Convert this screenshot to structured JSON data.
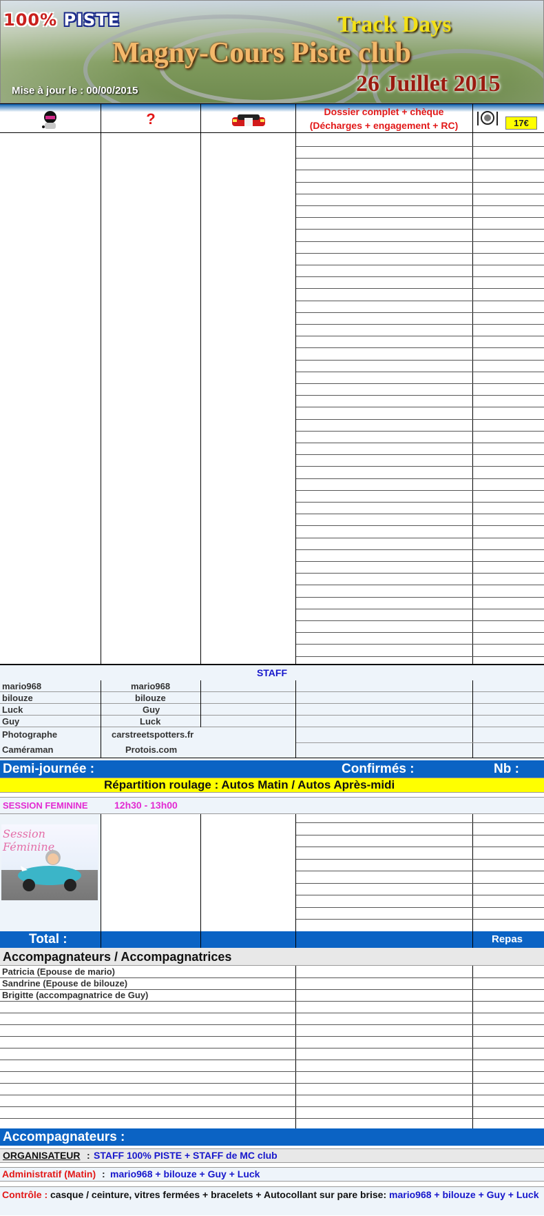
{
  "banner": {
    "brand_pct": "100%",
    "brand_name": "PISTE",
    "track_days": "Track Days",
    "title": "Magny-Cours  Piste club",
    "date": "26 Juillet 2015",
    "update": "Mise à jour le : 00/00/2015"
  },
  "header": {
    "col1_icon": "driver-helmet-icon",
    "col2_icon": "question-mark-icon",
    "col2_text": "?",
    "col3_icon": "red-car-icon",
    "dossier_line1": "Dossier complet + chèque",
    "dossier_line2": "(Décharges + engagement + RC)",
    "meal_icon": "cutlery-icon",
    "price": "17€"
  },
  "staff": {
    "title": "STAFF",
    "rows": [
      {
        "name": "mario968",
        "value": "mario968"
      },
      {
        "name": "bilouze",
        "value": "bilouze"
      },
      {
        "name": "Luck",
        "value": "Guy"
      },
      {
        "name": "Guy",
        "value": "Luck"
      }
    ],
    "extra": [
      {
        "name": "Photographe",
        "value": "carstreetspotters.fr"
      },
      {
        "name": "Caméraman",
        "value": "Protois.com"
      }
    ]
  },
  "demi": {
    "label": "Demi-journée :",
    "confirmes": "Confirmés  :",
    "nb": "Nb :"
  },
  "repartition": "Répartition roulage :  Autos Matin /  Autos Après-midi",
  "session": {
    "label": "SESSION FEMININE",
    "time": "12h30 - 13h00",
    "badge_text": "Session Féminine"
  },
  "total": {
    "label": "Total :",
    "repas": "Repas"
  },
  "accompagnateurs": {
    "title": "Accompagnateurs / Accompagnatrices",
    "list": [
      "Patricia (Epouse de mario)",
      "Sandrine (Epouse de bilouze)",
      "Brigitte (accompagnatrice de Guy)"
    ],
    "footer_label": "Accompagnateurs :"
  },
  "footer": {
    "organisateur_label": "ORGANISATEUR",
    "organisateur_value": "STAFF 100% PISTE + STAFF de MC club",
    "admin_label": "Administratif (Matin)",
    "admin_value": "mario968 + bilouze + Guy + Luck",
    "controle_label": "Contrôle :",
    "controle_text": "casque / ceinture, vitres fermées + bracelets + Autocollant sur pare brise:",
    "controle_names": "mario968 + bilouze + Guy + Luck"
  },
  "colors": {
    "accent_blue": "#0b63c4",
    "highlight_yellow": "#ffff00",
    "red": "#e21818",
    "magenta": "#e22ad2"
  }
}
